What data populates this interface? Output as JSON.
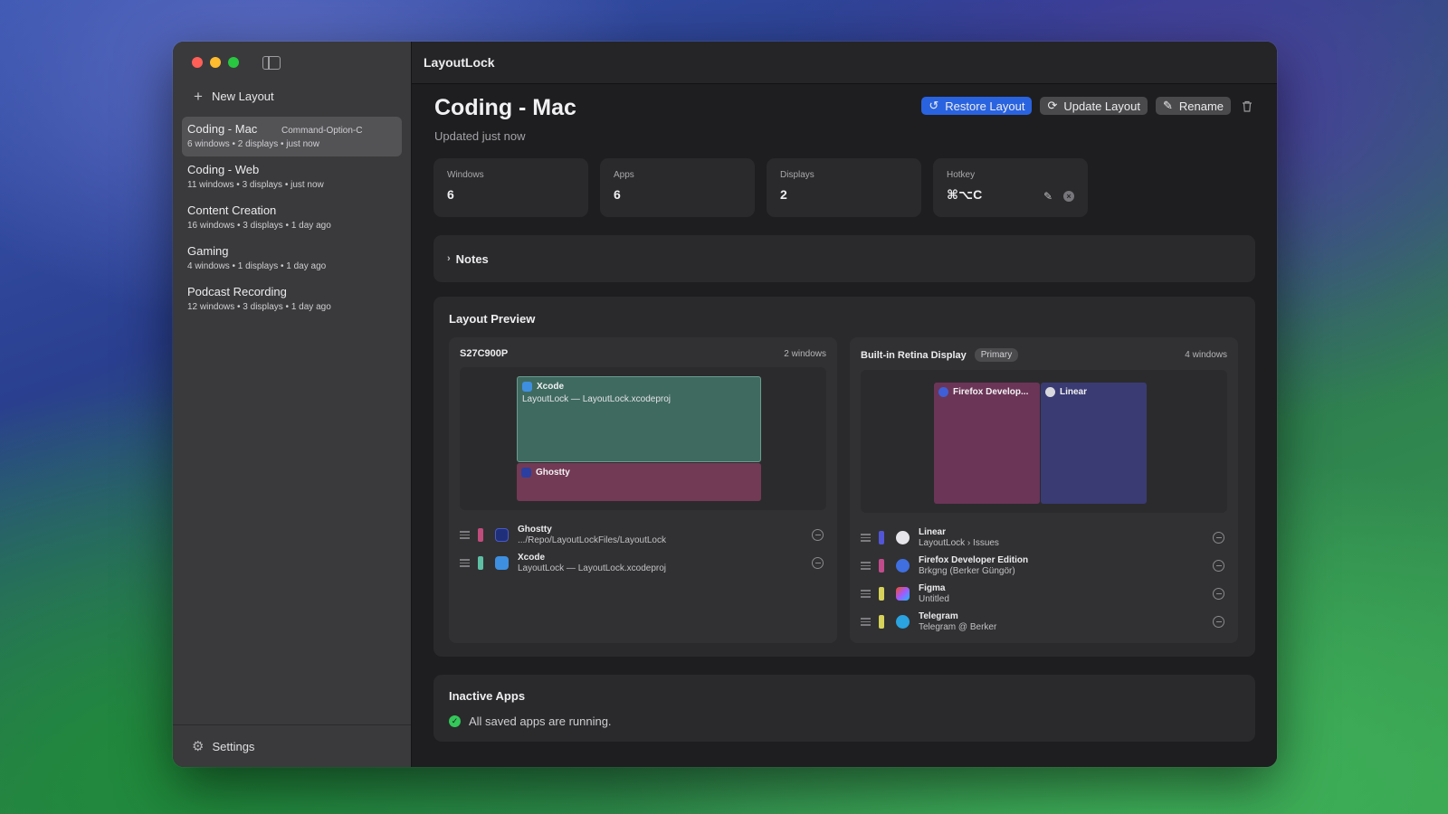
{
  "app": {
    "title": "LayoutLock"
  },
  "sidebar": {
    "new_layout_label": "New Layout",
    "items": [
      {
        "name": "Coding - Mac",
        "hotkey": "Command-Option-C",
        "meta": "6 windows • 2 displays • just now",
        "selected": true
      },
      {
        "name": "Coding - Web",
        "hotkey": "",
        "meta": "11 windows • 3 displays • just now"
      },
      {
        "name": "Content Creation",
        "hotkey": "",
        "meta": "16 windows • 3 displays • 1 day ago"
      },
      {
        "name": "Gaming",
        "hotkey": "",
        "meta": "4 windows • 1 displays • 1 day ago"
      },
      {
        "name": "Podcast Recording",
        "hotkey": "",
        "meta": "12 windows • 3 displays • 1 day ago"
      }
    ],
    "settings_label": "Settings"
  },
  "header": {
    "title": "Coding - Mac",
    "subtitle": "Updated just now",
    "buttons": {
      "restore": "Restore Layout",
      "update": "Update Layout",
      "rename": "Rename"
    }
  },
  "stats": {
    "windows": {
      "label": "Windows",
      "value": "6"
    },
    "apps": {
      "label": "Apps",
      "value": "6"
    },
    "displays": {
      "label": "Displays",
      "value": "2"
    },
    "hotkey": {
      "label": "Hotkey",
      "value": "⌘⌥C"
    }
  },
  "notes": {
    "label": "Notes"
  },
  "preview": {
    "title": "Layout Preview",
    "displays": [
      {
        "name": "S27C900P",
        "badge": "",
        "count": "2 windows",
        "windows": [
          {
            "app": "Xcode",
            "subtitle": "LayoutLock — LayoutLock.xcodeproj",
            "color": "#3f6a60"
          },
          {
            "app": "Ghostty",
            "subtitle": "",
            "color": "#733a55"
          }
        ],
        "rows": [
          {
            "title": "Ghostty",
            "sub": ".../Repo/LayoutLockFiles/LayoutLock",
            "swatch": "#c04c7c",
            "icon": "ghostty-icon"
          },
          {
            "title": "Xcode",
            "sub": "LayoutLock — LayoutLock.xcodeproj",
            "swatch": "#5fbfa5",
            "icon": "xcode-icon"
          }
        ]
      },
      {
        "name": "Built-in Retina Display",
        "badge": "Primary",
        "count": "4 windows",
        "windows": [
          {
            "app": "Firefox Develop...",
            "subtitle": "",
            "color": "#6b3557"
          },
          {
            "app": "Linear",
            "subtitle": "",
            "color": "#3a3b73"
          }
        ],
        "rows": [
          {
            "title": "Linear",
            "sub": "LayoutLock › Issues",
            "swatch": "#5256d6",
            "icon": "linear-icon"
          },
          {
            "title": "Firefox Developer Edition",
            "sub": "Brkgng (Berker Güngör)",
            "swatch": "#c04c8c",
            "icon": "firefox-icon"
          },
          {
            "title": "Figma",
            "sub": "Untitled",
            "swatch": "#d6d25a",
            "icon": "figma-icon"
          },
          {
            "title": "Telegram",
            "sub": "Telegram @ Berker",
            "swatch": "#d6d25a",
            "icon": "telegram-icon"
          }
        ]
      }
    ]
  },
  "inactive": {
    "title": "Inactive Apps",
    "message": "All saved apps are running."
  },
  "colors": {
    "accent": "#2a63e0",
    "success": "#34c759"
  }
}
